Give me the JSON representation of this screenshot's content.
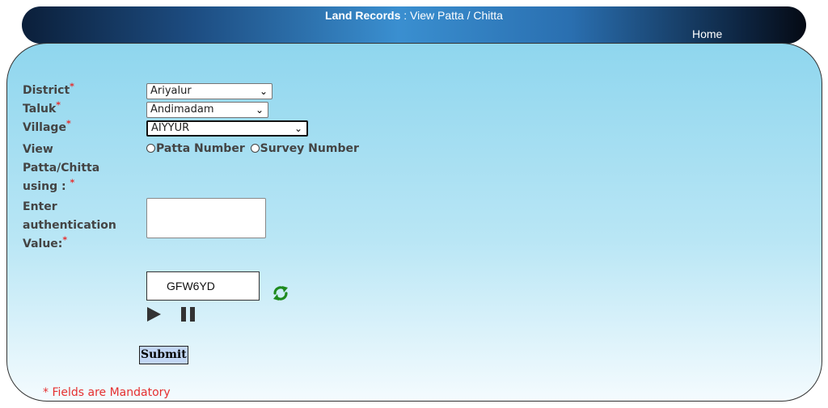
{
  "header": {
    "title_bold": "Land Records",
    "title_rest": " : View Patta / Chitta",
    "home": "Home"
  },
  "form": {
    "district": {
      "label": "District",
      "value": "Ariyalur"
    },
    "taluk": {
      "label": "Taluk",
      "value": "Andimadam"
    },
    "village": {
      "label": "Village",
      "value": "AIYYUR"
    },
    "view_using": {
      "label_line1": "View",
      "label_line2": "Patta/Chitta",
      "label_line3": "using :",
      "options": [
        "Patta Number",
        "Survey Number"
      ]
    },
    "auth": {
      "label_line1": "Enter",
      "label_line2": "authentication",
      "label_line3": "Value:",
      "value": ""
    },
    "captcha": {
      "text": "GFW6YD"
    },
    "required_mark": "*",
    "submit_label": "Submit",
    "mandatory_note": "* Fields are Mandatory"
  },
  "colors": {
    "required": "#e53030",
    "refresh_icon": "#1e8a1e",
    "submit_bg": "#c2d6f4"
  }
}
